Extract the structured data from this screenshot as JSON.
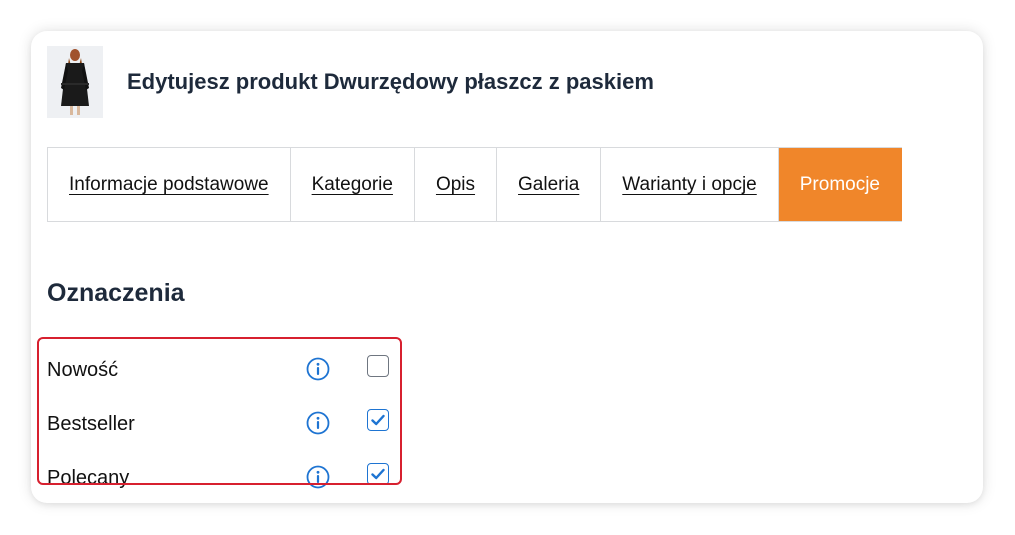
{
  "header": {
    "title": "Edytujesz produkt Dwurzędowy płaszcz z paskiem",
    "thumbnail_icon": "coat-image"
  },
  "tabs": [
    {
      "label": "Informacje podstawowe",
      "active": false
    },
    {
      "label": "Kategorie",
      "active": false
    },
    {
      "label": "Opis",
      "active": false
    },
    {
      "label": "Galeria",
      "active": false
    },
    {
      "label": "Warianty i opcje",
      "active": false
    },
    {
      "label": "Promocje",
      "active": true
    }
  ],
  "section": {
    "title": "Oznaczenia",
    "items": [
      {
        "label": "Nowość",
        "checked": false,
        "icon": "info-icon"
      },
      {
        "label": "Bestseller",
        "checked": true,
        "icon": "info-icon"
      },
      {
        "label": "Polecany",
        "checked": true,
        "icon": "info-icon"
      }
    ]
  },
  "colors": {
    "accent": "#f0862a",
    "checkbox": "#1e74d2",
    "highlight": "#d7202f",
    "title": "#1e2a3b"
  }
}
